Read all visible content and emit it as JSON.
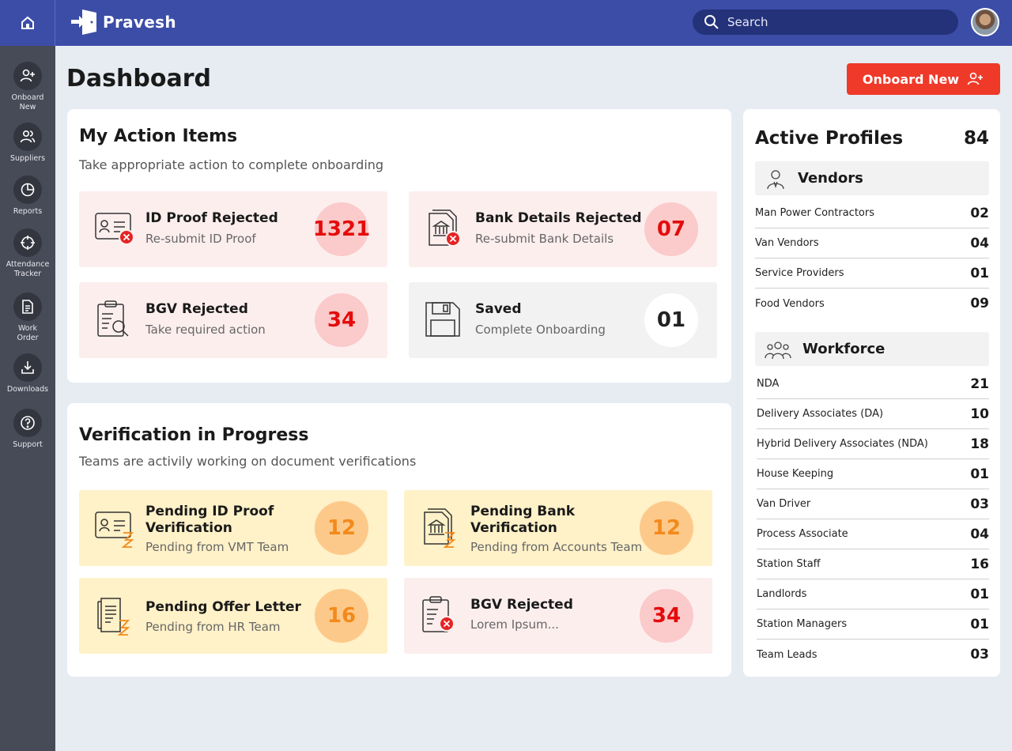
{
  "brand": {
    "name": "Pravesh"
  },
  "search": {
    "label": "Search"
  },
  "sidebar": {
    "items": [
      {
        "label": "Onboard\nNew",
        "icon": "person-add-icon"
      },
      {
        "label": "Suppliers",
        "icon": "people-icon"
      },
      {
        "label": "Reports",
        "icon": "pie-chart-icon"
      },
      {
        "label": "Attendance\nTracker",
        "icon": "crosshair-icon"
      },
      {
        "label": "Work\nOrder",
        "icon": "document-icon"
      },
      {
        "label": "Downloads",
        "icon": "download-icon"
      },
      {
        "label": "Support",
        "icon": "help-icon"
      }
    ]
  },
  "header": {
    "title": "Dashboard",
    "onboard_label": "Onboard New"
  },
  "action_items": {
    "title": "My Action Items",
    "subtitle": "Take appropriate action to complete onboarding",
    "tiles": [
      {
        "title": "ID Proof Rejected",
        "sub": "Re-submit ID Proof",
        "count": "1321",
        "icon": "id-card-rejected-icon"
      },
      {
        "title": "Bank Details Rejected",
        "sub": "Re-submit Bank Details",
        "count": "07",
        "icon": "bank-document-rejected-icon"
      },
      {
        "title": "BGV Rejected",
        "sub": "Take required action",
        "count": "34",
        "icon": "clipboard-search-icon"
      },
      {
        "title": "Saved",
        "sub": "Complete Onboarding",
        "count": "01",
        "icon": "save-icon"
      }
    ]
  },
  "verification": {
    "title": "Verification in Progress",
    "subtitle": "Teams are activily working on document verifications",
    "tiles": [
      {
        "title_line1": "Pending ID Proof",
        "title_line2": "Verification",
        "sub": "Pending from VMT Team",
        "count": "12",
        "icon": "id-card-pending-icon"
      },
      {
        "title_line1": "Pending Bank",
        "title_line2": "Verification",
        "sub": "Pending from Accounts Team",
        "count": "12",
        "icon": "bank-document-pending-icon"
      },
      {
        "title": "Pending Offer Letter",
        "sub": "Pending from HR Team",
        "count": "16",
        "icon": "letter-pending-icon"
      },
      {
        "title": "BGV Rejected",
        "sub": "Lorem Ipsum...",
        "count": "34",
        "icon": "clipboard-rejected-icon"
      }
    ]
  },
  "profiles": {
    "title": "Active Profiles",
    "total": "84",
    "vendors": {
      "label": "Vendors",
      "rows": [
        {
          "name": "Man Power Contractors",
          "value": "02"
        },
        {
          "name": "Van Vendors",
          "value": "04"
        },
        {
          "name": "Service Providers",
          "value": "01"
        },
        {
          "name": "Food Vendors",
          "value": "09"
        }
      ]
    },
    "workforce": {
      "label": "Workforce",
      "rows": [
        {
          "name": "NDA",
          "value": "21"
        },
        {
          "name": "Delivery Associates (DA)",
          "value": "10"
        },
        {
          "name": "Hybrid Delivery Associates (NDA)",
          "value": "18"
        },
        {
          "name": "House Keeping",
          "value": "01"
        },
        {
          "name": "Van Driver",
          "value": "03"
        },
        {
          "name": "Process Associate",
          "value": "04"
        },
        {
          "name": "Station Staff",
          "value": "16"
        },
        {
          "name": "Landlords",
          "value": "01"
        },
        {
          "name": "Station Managers",
          "value": "01"
        },
        {
          "name": "Team Leads",
          "value": "03"
        }
      ]
    }
  },
  "colors": {
    "topbar": "#3c4da7",
    "sidebar": "#474a57",
    "accent_red": "#ef3a2a",
    "pending_orange": "#f28a1b"
  }
}
